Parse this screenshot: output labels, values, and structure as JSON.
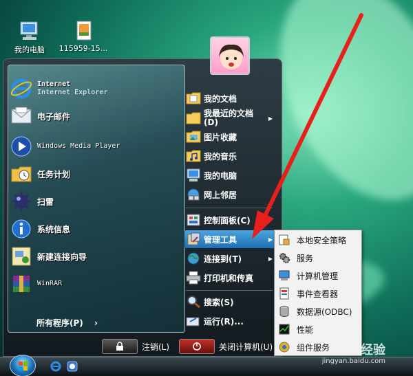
{
  "desktop": {
    "icons": [
      {
        "label": "我的电脑"
      },
      {
        "label": "115959-15..."
      }
    ]
  },
  "start_menu": {
    "left_programs": [
      {
        "title": "Internet",
        "subtitle": "Internet Explorer",
        "icon": "ie-icon"
      },
      {
        "title": "电子邮件",
        "icon": "mail-icon"
      },
      {
        "title": "Windows Media Player",
        "icon": "media-player-icon"
      },
      {
        "title": "任务计划",
        "icon": "task-scheduler-icon"
      },
      {
        "title": "扫雷",
        "icon": "minesweeper-icon"
      },
      {
        "title": "系统信息",
        "icon": "info-icon"
      },
      {
        "title": "新建连接向导",
        "icon": "network-wizard-icon"
      },
      {
        "title": "WinRAR",
        "icon": "winrar-icon"
      }
    ],
    "all_programs": "所有程序(P)",
    "right_items": [
      {
        "label": "我的文档"
      },
      {
        "label": "我最近的文档",
        "label2": "(D)"
      },
      {
        "label": "图片收藏"
      },
      {
        "label": "我的音乐"
      },
      {
        "label": "我的电脑"
      },
      {
        "label": "网上邻居"
      },
      {
        "label": "控制面板(C)"
      },
      {
        "label": "管理工具"
      },
      {
        "label": "连接到(T)"
      },
      {
        "label": "打印机和传真"
      },
      {
        "label": "搜索(S)"
      },
      {
        "label": "运行(R)..."
      }
    ],
    "logoff": "注销(L)",
    "shutdown": "关闭计算机(U)"
  },
  "submenu": {
    "items": [
      {
        "label": "本地安全策略"
      },
      {
        "label": "服务"
      },
      {
        "label": "计算机管理"
      },
      {
        "label": "事件查看器"
      },
      {
        "label": "数据源(ODBC)"
      },
      {
        "label": "性能"
      },
      {
        "label": "组件服务"
      }
    ]
  },
  "watermark": {
    "text": "经验",
    "url": "jingyan.baidu.com"
  },
  "colors": {
    "highlight": "#2f86cc",
    "arrow": "#e8201c"
  }
}
